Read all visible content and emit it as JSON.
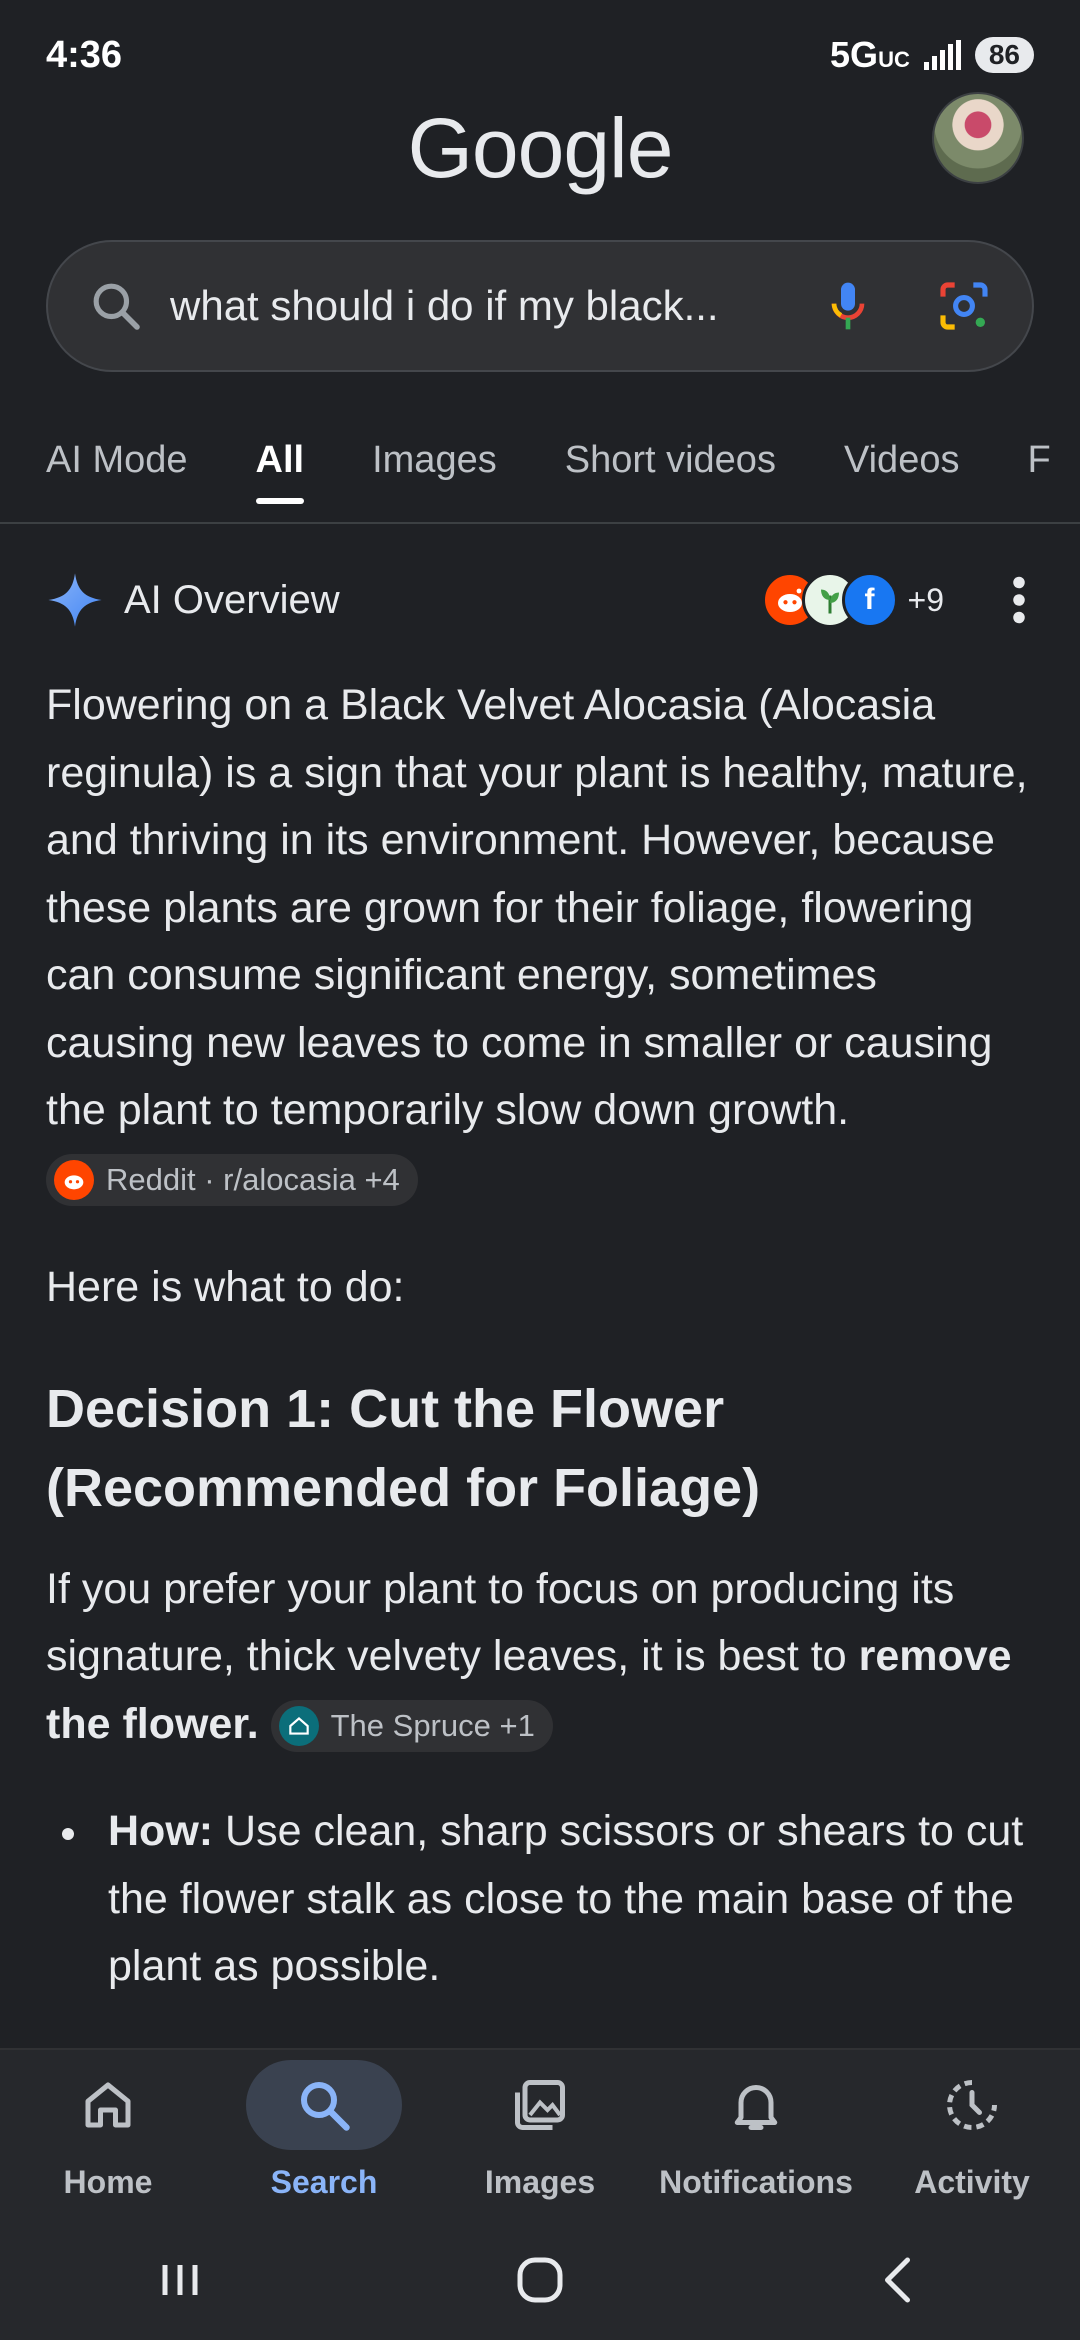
{
  "status": {
    "time": "4:36",
    "network": "5G",
    "network_sub": "UC",
    "battery": "86"
  },
  "header": {
    "logo": "Google"
  },
  "search": {
    "query": "what should i do if my black..."
  },
  "tabs": [
    {
      "label": "AI Mode"
    },
    {
      "label": "All"
    },
    {
      "label": "Images"
    },
    {
      "label": "Short videos"
    },
    {
      "label": "Videos"
    },
    {
      "label": "F"
    }
  ],
  "ai_overview": {
    "title": "AI Overview",
    "source_count": "+9",
    "intro": "Flowering on a Black Velvet Alocasia (Alocasia reginula) is a sign that your plant is healthy, mature, and thriving in its environment. However, because these plants are grown for their foliage, flowering can consume significant energy, sometimes causing new leaves to come in smaller or causing the plant to temporarily slow down growth.",
    "intro_chip": "Reddit · r/alocasia +4",
    "lead": "Here is what to do:",
    "heading": "Decision 1: Cut the Flower (Recommended for Foliage)",
    "decision_text": "If you prefer your plant to focus on producing its signature, thick velvety leaves, it is best to",
    "decision_bold": "remove the flower.",
    "decision_chip": "The Spruce +1",
    "bullet_label": "How:",
    "bullet_text": "Use clean, sharp scissors or shears to cut the flower stalk as close to the main base of the plant as possible."
  },
  "bottom_nav": [
    {
      "label": "Home",
      "icon": "home-icon"
    },
    {
      "label": "Search",
      "icon": "search-icon"
    },
    {
      "label": "Images",
      "icon": "images-icon"
    },
    {
      "label": "Notifications",
      "icon": "bell-icon"
    },
    {
      "label": "Activity",
      "icon": "activity-icon"
    }
  ],
  "colors": {
    "background": "#1f2125",
    "accent": "#8ab4f8",
    "surface": "#303134"
  }
}
